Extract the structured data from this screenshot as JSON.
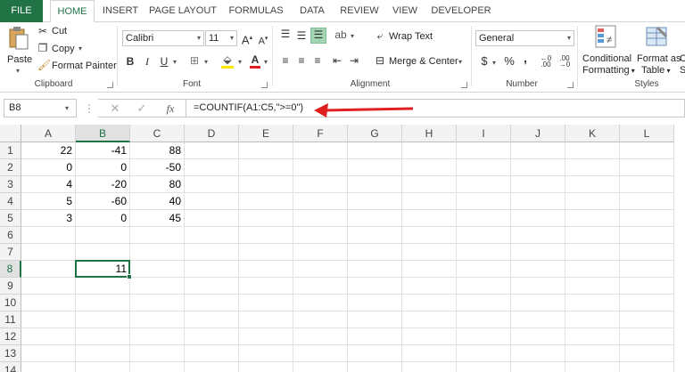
{
  "tabs": [
    "FILE",
    "HOME",
    "INSERT",
    "PAGE LAYOUT",
    "FORMULAS",
    "DATA",
    "REVIEW",
    "VIEW",
    "DEVELOPER"
  ],
  "active_tab": "HOME",
  "clipboard": {
    "paste": "Paste",
    "cut": "Cut",
    "copy": "Copy",
    "format_painter": "Format Painter",
    "label": "Clipboard"
  },
  "font": {
    "name": "Calibri",
    "size": "11",
    "label": "Font",
    "bold": "B",
    "italic": "I",
    "underline": "U",
    "grow": "A",
    "shrink": "A",
    "color_letter": "A"
  },
  "alignment": {
    "wrap": "Wrap Text",
    "merge": "Merge & Center",
    "label": "Alignment"
  },
  "number": {
    "format": "General",
    "currency": "$",
    "percent": "%",
    "comma": ",",
    "label": "Number"
  },
  "styles": {
    "conditional_1": "Conditional",
    "conditional_2": "Formatting",
    "format_as_1": "Format as",
    "format_as_2": "Table",
    "cell_styles_1": "C",
    "cell_styles_2": "St",
    "label": "Styles"
  },
  "formula_bar": {
    "name_box": "B8",
    "fx": "fx",
    "formula": "=COUNTIF(A1:C5,\">=0\")"
  },
  "columns": [
    "A",
    "B",
    "C",
    "D",
    "E",
    "F",
    "G",
    "H",
    "I",
    "J",
    "K",
    "L"
  ],
  "rows": [
    "1",
    "2",
    "3",
    "4",
    "5",
    "6",
    "7",
    "8",
    "9",
    "10",
    "11",
    "12",
    "13",
    "14"
  ],
  "selected_cell": "B8",
  "cells": {
    "A1": "22",
    "B1": "-41",
    "C1": "88",
    "A2": "0",
    "B2": "0",
    "C2": "-50",
    "A3": "4",
    "B3": "-20",
    "C3": "80",
    "A4": "5",
    "B4": "-60",
    "C4": "40",
    "A5": "3",
    "B5": "0",
    "C5": "45",
    "B8": "11"
  },
  "colors": {
    "accent": "#217346",
    "arrow": "#e02020"
  }
}
